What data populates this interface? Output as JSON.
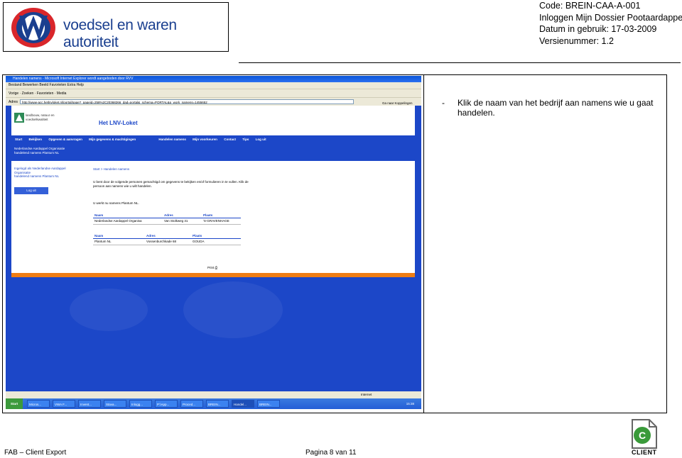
{
  "header": {
    "logo_text": "voedsel en waren autoriteit",
    "code": "Code: BREIN-CAA-A-001",
    "title": "Inloggen Mijn Dossier Pootaardappelen",
    "date": "Datum in gebruik: 17-03-2009",
    "version": "Versienummer: 1.2"
  },
  "instruction": {
    "bullet": "-",
    "text": "Klik de naam van het bedrijf aan namens wie u gaat handelen."
  },
  "footer": {
    "left": "FAB – Client Export",
    "center": "Pagina 8 van 11",
    "client_label": "CLIENT"
  },
  "screenshot": {
    "window_title": "Handelen namens - Microsoft Internet Explorer wordt aangeboden door RVV",
    "menu": "Bestand   Bewerken   Beeld   Favorieten   Extra   Help",
    "toolbar": "Vorige  ·  Zoeken  ·  Favorieten  ·  Media",
    "address_label": "Adres",
    "url": "http://www-acc.hetlnvloket.nl/portal/page?_pageid=258%2C20368266_dad=portal&_schema=PORTAL&p_work_namens=1455652",
    "go": "Ga naar  Koppelingen",
    "org_line1": "landbouw, natuur en",
    "org_line2": "voedselkwaliteit",
    "portal_title": "Het LNV-Loket",
    "nav": [
      "Start",
      "Bekijken",
      "Opgeven & aanvragen",
      "Mijn gegevens & machtigingen",
      "Handelen namens",
      "Mijn voorkeuren",
      "Contact",
      "Tips",
      "Log uit"
    ],
    "crumbbar_line1": "Nederlandse Aardappel Organisatie",
    "crumbbar_line2": "handelend namens Plantum NL",
    "sidebar_line1": "Ingelogd als Nederlandse Aardappel",
    "sidebar_line2": "Organisatie",
    "sidebar_line3": "handelend namens Plantum NL",
    "logout": "Log uit",
    "breadcrumb": "Start > Handelen namens",
    "intro": "U bent door de volgende personen gemachtigd om gegevens te bekijken en/of formulieren in te vullen. Klik de persoon aan namens wie u wilt handelen.",
    "working": "U werkt nu namens Plantum NL.",
    "table1": {
      "headers": [
        "Naam",
        "Adres",
        "Plaats"
      ],
      "row": [
        "Nederlandse Aardappel Organisa",
        "Van Stolkweg 31",
        "'S-GRAVENHAGE"
      ]
    },
    "table2": {
      "headers": [
        "Naam",
        "Adres",
        "Plaats"
      ],
      "row": [
        "Plantum NL",
        "Vossenburchkade 68",
        "GOUDA"
      ]
    },
    "print": "Print",
    "status_zone": "Internet",
    "taskbar_start": "Start",
    "tasks": [
      "Micros...",
      "VWA F...",
      "Invent...",
      "Stava...",
      "Inlogg...",
      "P:\\App...",
      "Proced...",
      "BREIN...",
      "Handel...",
      "BREIN..."
    ],
    "clock": "15:38"
  }
}
